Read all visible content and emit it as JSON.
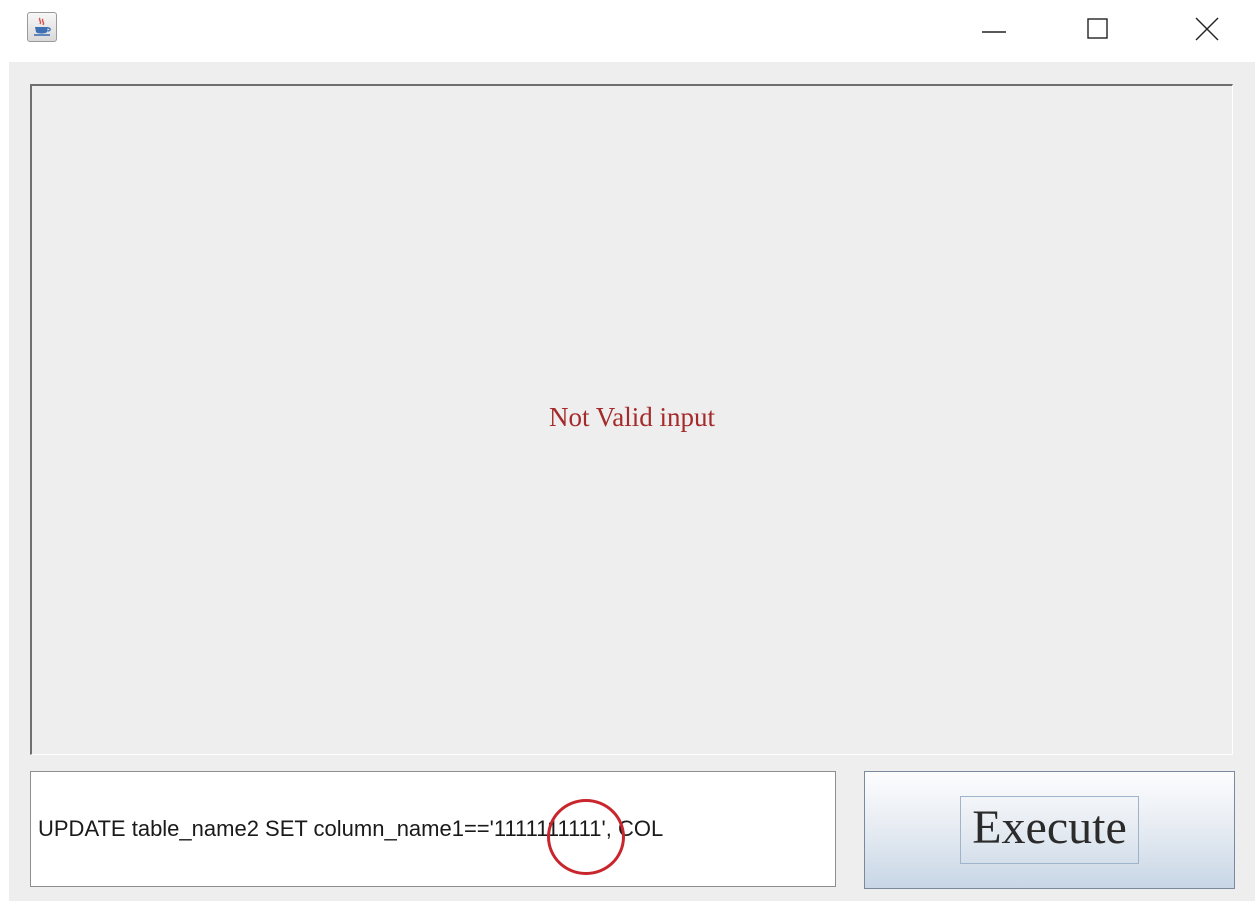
{
  "titlebar": {
    "icons": {
      "app": "java-coffee-cup-icon",
      "minimize": "minimize-icon",
      "maximize": "maximize-icon",
      "close": "close-icon"
    }
  },
  "output": {
    "message": "Not Valid input",
    "message_color": "#a52a2a"
  },
  "query": {
    "value": "UPDATE table_name2 SET column_name1=='1111111111', COL"
  },
  "annotation": {
    "color": "#c8262c"
  },
  "execute": {
    "label": "Execute"
  }
}
